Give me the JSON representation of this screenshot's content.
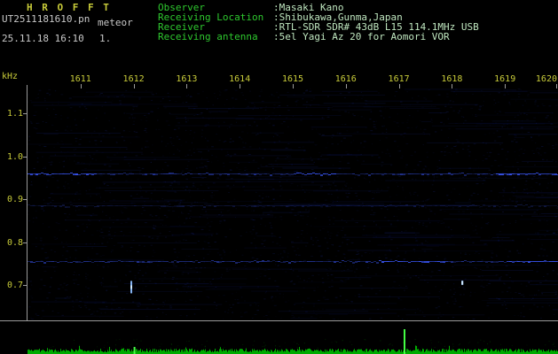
{
  "header": {
    "title": "H R O F F T",
    "filename": "UT2511181610.pn",
    "station": "meteor",
    "datetime": "25.11.18 16:10",
    "counter": "1.",
    "fields": [
      {
        "label": "Observer",
        "value": ":Masaki Kano"
      },
      {
        "label": "Receiving Location",
        "value": ":Shibukawa,Gunma,Japan"
      },
      {
        "label": "Receiver",
        "value": ":RTL-SDR SDR# 43dB L15 114.1MHz USB"
      },
      {
        "label": "Receiving antenna",
        "value": ":5el Yagi Az 20 for Aomori VOR"
      }
    ]
  },
  "chart_data": {
    "type": "heatmap",
    "subtype": "radio-meteor-spectrogram",
    "ylabel": "kHz",
    "y_ticks": [
      "1.1",
      "1.0",
      "0.9",
      "0.8",
      "0.7"
    ],
    "y_tick_values_khz": [
      1.1,
      1.0,
      0.9,
      0.8,
      0.7
    ],
    "x_ticks": [
      "1611",
      "1612",
      "1613",
      "1614",
      "1615",
      "1616",
      "1617",
      "1618",
      "1619",
      "1620"
    ],
    "x_start_ut": "1610",
    "x_end_ut": "1620",
    "carriers": [
      {
        "f_khz": 0.96,
        "intensity": 0.5,
        "bright_segments": [
          [
            0.0,
            0.13
          ],
          [
            0.5,
            0.58
          ],
          [
            0.88,
            1.0
          ]
        ]
      },
      {
        "f_khz": 0.885,
        "intensity": 0.22,
        "bright_segments": []
      },
      {
        "f_khz": 0.755,
        "intensity": 0.5,
        "bright_segments": [
          [
            0.66,
            0.79
          ],
          [
            0.9,
            1.0
          ]
        ]
      }
    ],
    "echoes": [
      {
        "x_frac": 0.194,
        "f_khz": 0.695,
        "h": 14,
        "bright": 0.95
      },
      {
        "x_frac": 0.818,
        "f_khz": 0.705,
        "h": 5,
        "bright": 0.85
      }
    ],
    "bottom_strip": {
      "spikes": [
        {
          "x_frac": 0.709,
          "h": 27
        },
        {
          "x_frac": 0.2,
          "h": 7
        }
      ]
    }
  },
  "colors": {
    "background": "#000000",
    "title_yellow": "#c9cc3a",
    "axis_text": "#c9cc3a",
    "label_green": "#2ec82e",
    "value_green": "#bfe6bf",
    "text_white": "#c8c8c8",
    "axis_line": "#9a9a9a",
    "carrier_blue": "#3752eb",
    "echo_blue": "#8cbeff",
    "signal_green": "#00be00"
  }
}
